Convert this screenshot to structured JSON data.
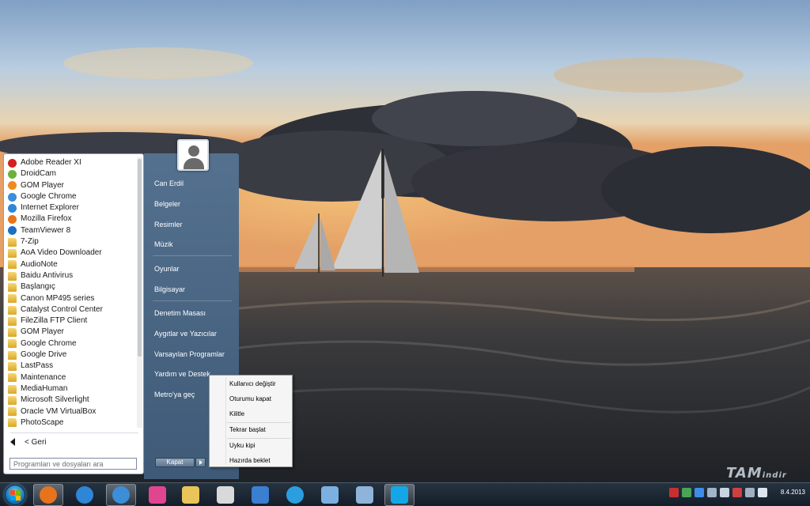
{
  "start_menu": {
    "programs": [
      {
        "label": "Adobe Reader XI",
        "icon": "adobe-reader-icon",
        "color": "#d4201e"
      },
      {
        "label": "DroidCam",
        "icon": "droidcam-icon",
        "color": "#6bb13a"
      },
      {
        "label": "GOM Player",
        "icon": "gom-player-icon",
        "color": "#f08a1d"
      },
      {
        "label": "Google Chrome",
        "icon": "chrome-icon",
        "color": "#3c8ed8"
      },
      {
        "label": "Internet Explorer",
        "icon": "ie-icon",
        "color": "#2e86d6"
      },
      {
        "label": "Mozilla Firefox",
        "icon": "firefox-icon",
        "color": "#e7731d"
      },
      {
        "label": "TeamViewer 8",
        "icon": "teamviewer-icon",
        "color": "#1b6fc4"
      },
      {
        "label": "7-Zip",
        "icon": "folder-icon",
        "color": ""
      },
      {
        "label": "AoA Video Downloader",
        "icon": "folder-icon",
        "color": ""
      },
      {
        "label": "AudioNote",
        "icon": "folder-icon",
        "color": ""
      },
      {
        "label": "Baidu Antivirus",
        "icon": "folder-icon",
        "color": ""
      },
      {
        "label": "Başlangıç",
        "icon": "folder-icon",
        "color": ""
      },
      {
        "label": "Canon MP495 series",
        "icon": "folder-icon",
        "color": ""
      },
      {
        "label": "Catalyst Control Center",
        "icon": "folder-icon",
        "color": ""
      },
      {
        "label": "FileZilla FTP Client",
        "icon": "folder-icon",
        "color": ""
      },
      {
        "label": "GOM Player",
        "icon": "folder-icon",
        "color": ""
      },
      {
        "label": "Google Chrome",
        "icon": "folder-icon",
        "color": ""
      },
      {
        "label": "Google Drive",
        "icon": "folder-icon",
        "color": ""
      },
      {
        "label": "LastPass",
        "icon": "folder-icon",
        "color": ""
      },
      {
        "label": "Maintenance",
        "icon": "folder-icon",
        "color": ""
      },
      {
        "label": "MediaHuman",
        "icon": "folder-icon",
        "color": ""
      },
      {
        "label": "Microsoft Silverlight",
        "icon": "folder-icon",
        "color": ""
      },
      {
        "label": "Oracle VM VirtualBox",
        "icon": "folder-icon",
        "color": ""
      },
      {
        "label": "PhotoScape",
        "icon": "folder-icon",
        "color": ""
      }
    ],
    "back_label": "< Geri",
    "search_placeholder": "Programları ve dosyaları ara",
    "places": {
      "user": "Can Erdil",
      "documents": "Belgeler",
      "pictures": "Resimler",
      "music": "Müzik",
      "games": "Oyunlar",
      "computer": "Bilgisayar",
      "control_panel": "Denetim Masası",
      "devices": "Aygıtlar ve Yazıcılar",
      "default_programs": "Varsayılan Programlar",
      "help": "Yardım ve Destek",
      "metro": "Metro'ya geç"
    },
    "shutdown_label": "Kapat"
  },
  "power_menu": {
    "switch_user": "Kullanıcı değiştir",
    "log_off": "Oturumu kapat",
    "lock": "Kilitle",
    "restart": "Tekrar başlat",
    "sleep": "Uyku kipi",
    "hibernate": "Hazırda beklet"
  },
  "taskbar": {
    "pinned": [
      {
        "name": "firefox",
        "color": "#e7731d"
      },
      {
        "name": "internet-explorer",
        "color": "#2e86d6"
      },
      {
        "name": "chrome",
        "color": "#3c8ed8"
      },
      {
        "name": "heart-app",
        "color": "#e0458f"
      },
      {
        "name": "file-explorer",
        "color": "#e8c45a"
      },
      {
        "name": "media-player",
        "color": "#d9d9d9"
      },
      {
        "name": "download-manager",
        "color": "#3a7fd0"
      },
      {
        "name": "globe-app",
        "color": "#2b9ee0"
      },
      {
        "name": "drawing-tool",
        "color": "#7bb0e0"
      },
      {
        "name": "virtualbox",
        "color": "#8fb3d9"
      },
      {
        "name": "skype",
        "color": "#13a7e8"
      }
    ],
    "tray_icons": [
      {
        "name": "shield",
        "color": "#c83030"
      },
      {
        "name": "google-drive",
        "color": "#4aa456"
      },
      {
        "name": "dropbox",
        "color": "#3d8ee8"
      },
      {
        "name": "monitor",
        "color": "#9fb4c8"
      },
      {
        "name": "network",
        "color": "#c9d6e2"
      },
      {
        "name": "flag",
        "color": "#d04040"
      },
      {
        "name": "tv",
        "color": "#a0b0c0"
      },
      {
        "name": "volume",
        "color": "#dde6ee"
      }
    ],
    "date": "8.4.2013"
  },
  "watermark": {
    "main": "TAM",
    "sub": "indir"
  }
}
